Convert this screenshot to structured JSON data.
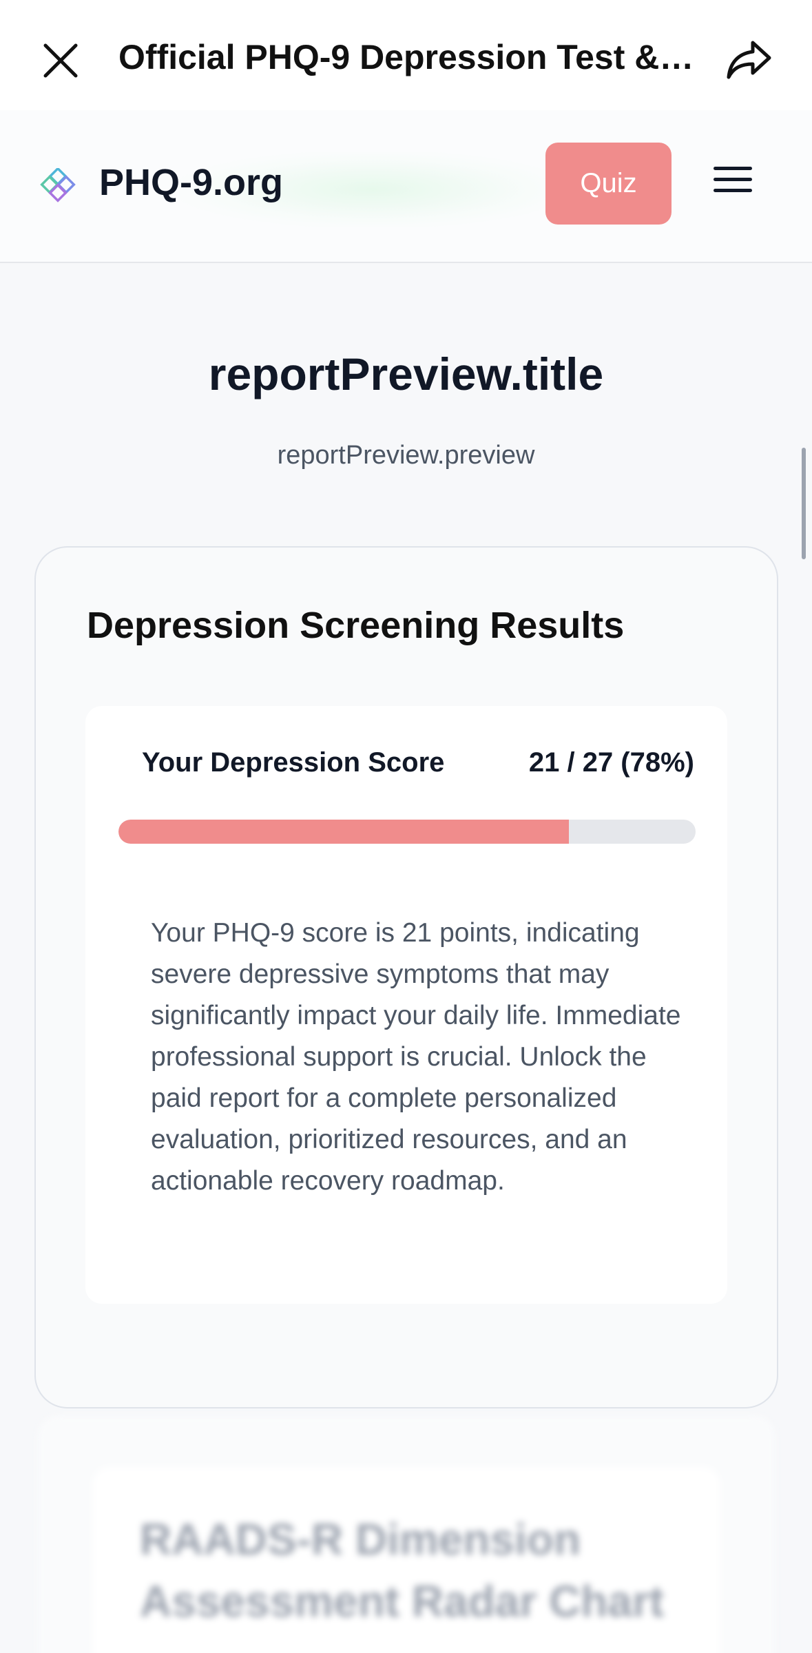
{
  "browser": {
    "title": "Official PHQ-9 Depression Test &…"
  },
  "header": {
    "site_name": "PHQ-9.org",
    "quiz_label": "Quiz"
  },
  "page": {
    "title": "reportPreview.title",
    "subtitle": "reportPreview.preview"
  },
  "results": {
    "heading": "Depression Screening Results",
    "score_label": "Your Depression Score",
    "score_value": "21 / 27 (78%)",
    "progress_fraction": 0.78,
    "description": "Your PHQ-9 score is 21 points, indicating severe depressive symptoms that may significantly impact your daily life. Immediate professional support is crucial. Unlock the paid report for a complete personalized evaluation, prioritized resources, and an actionable recovery roadmap."
  },
  "locked_section": {
    "title": "RAADS-R Dimension Assessment Radar Chart"
  },
  "colors": {
    "accent": "#f08c8c",
    "text": "#111827",
    "muted": "#4b5563"
  },
  "icons": {
    "close": "close-icon",
    "share": "share-icon",
    "logo": "diamond-logo-icon",
    "menu": "hamburger-menu-icon"
  }
}
